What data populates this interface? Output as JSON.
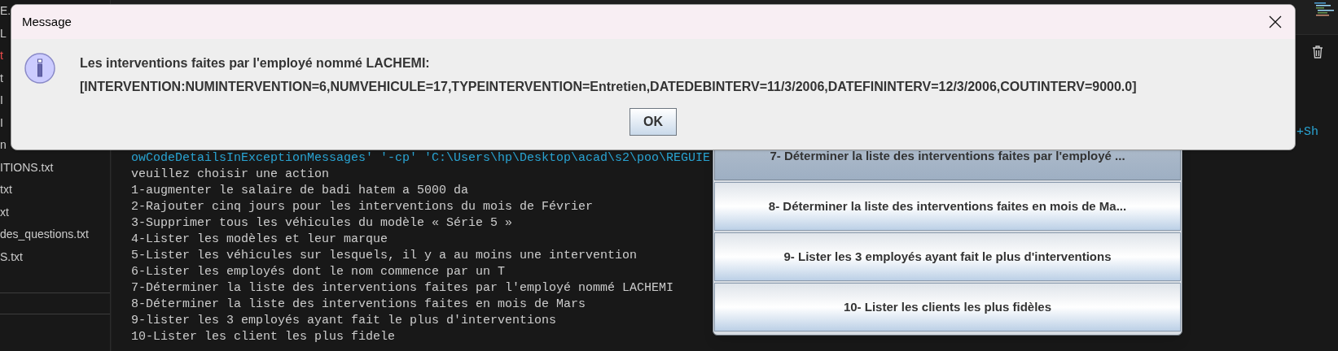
{
  "sidebar": {
    "items": [
      {
        "label": "E.",
        "modified": false
      },
      {
        "label": "L",
        "modified": false
      },
      {
        "label": "t",
        "modified": true
      },
      {
        "label": "t",
        "modified": false
      },
      {
        "label": "I",
        "modified": false
      },
      {
        "label": "I",
        "modified": false
      },
      {
        "label": "n",
        "modified": false
      },
      {
        "label": "ITIONS.txt",
        "modified": false
      },
      {
        "label": "txt",
        "modified": false
      },
      {
        "label": "xt",
        "modified": false
      },
      {
        "label": "des_questions.txt",
        "modified": false
      },
      {
        "label": "S.txt",
        "modified": false
      }
    ]
  },
  "terminal": {
    "hint": "+Sh",
    "lines": [
      {
        "kind": "command",
        "text": "owCodeDetailsInExceptionMessages' '-cp' 'C:\\Users\\hp\\Desktop\\acad\\s2\\poo\\REGUIE"
      },
      {
        "kind": "output",
        "text": "veuillez choisir une action"
      },
      {
        "kind": "output",
        "text": "1-augmenter le salaire de badi hatem a 5000 da"
      },
      {
        "kind": "output",
        "text": "2-Rajouter cinq jours pour les interventions du mois de Février"
      },
      {
        "kind": "output",
        "text": "3-Supprimer tous les véhicules du modèle « Série 5 »"
      },
      {
        "kind": "output",
        "text": "4-Lister les modèles et leur marque"
      },
      {
        "kind": "output",
        "text": "5-Lister les véhicules sur lesquels, il y a au moins une intervention"
      },
      {
        "kind": "output",
        "text": "6-Lister les employés dont le nom commence par un T"
      },
      {
        "kind": "output",
        "text": "7-Déterminer la liste des interventions faites par l'employé nommé LACHEMI"
      },
      {
        "kind": "output",
        "text": "8-Déterminer la liste des interventions faites en mois de Mars"
      },
      {
        "kind": "output",
        "text": "9-lister les 3 employés ayant fait le plus d'interventions"
      },
      {
        "kind": "output",
        "text": "10-Lister les client les plus fidele"
      }
    ]
  },
  "menu_window": {
    "buttons": [
      {
        "label": "7- Déterminer la liste des interventions faites par l'employé ...",
        "selected": true
      },
      {
        "label": "8- Déterminer la liste des interventions faites en mois de Ma...",
        "selected": false
      },
      {
        "label": "9- Lister les 3 employés ayant fait le plus d'interventions",
        "selected": false
      },
      {
        "label": "10- Lister les clients les plus fidèles",
        "selected": false
      }
    ]
  },
  "dialog": {
    "title": "Message",
    "message_lines": [
      "Les interventions faites par l'employé nommé LACHEMI:",
      "[INTERVENTION:NUMINTERVENTION=6,NUMVEHICULE=17,TYPEINTERVENTION=Entretien,DATEDEBINTERV=11/3/2006,DATEFININTERV=12/3/2006,COUTINTERV=9000.0]"
    ],
    "ok_button": "OK"
  }
}
